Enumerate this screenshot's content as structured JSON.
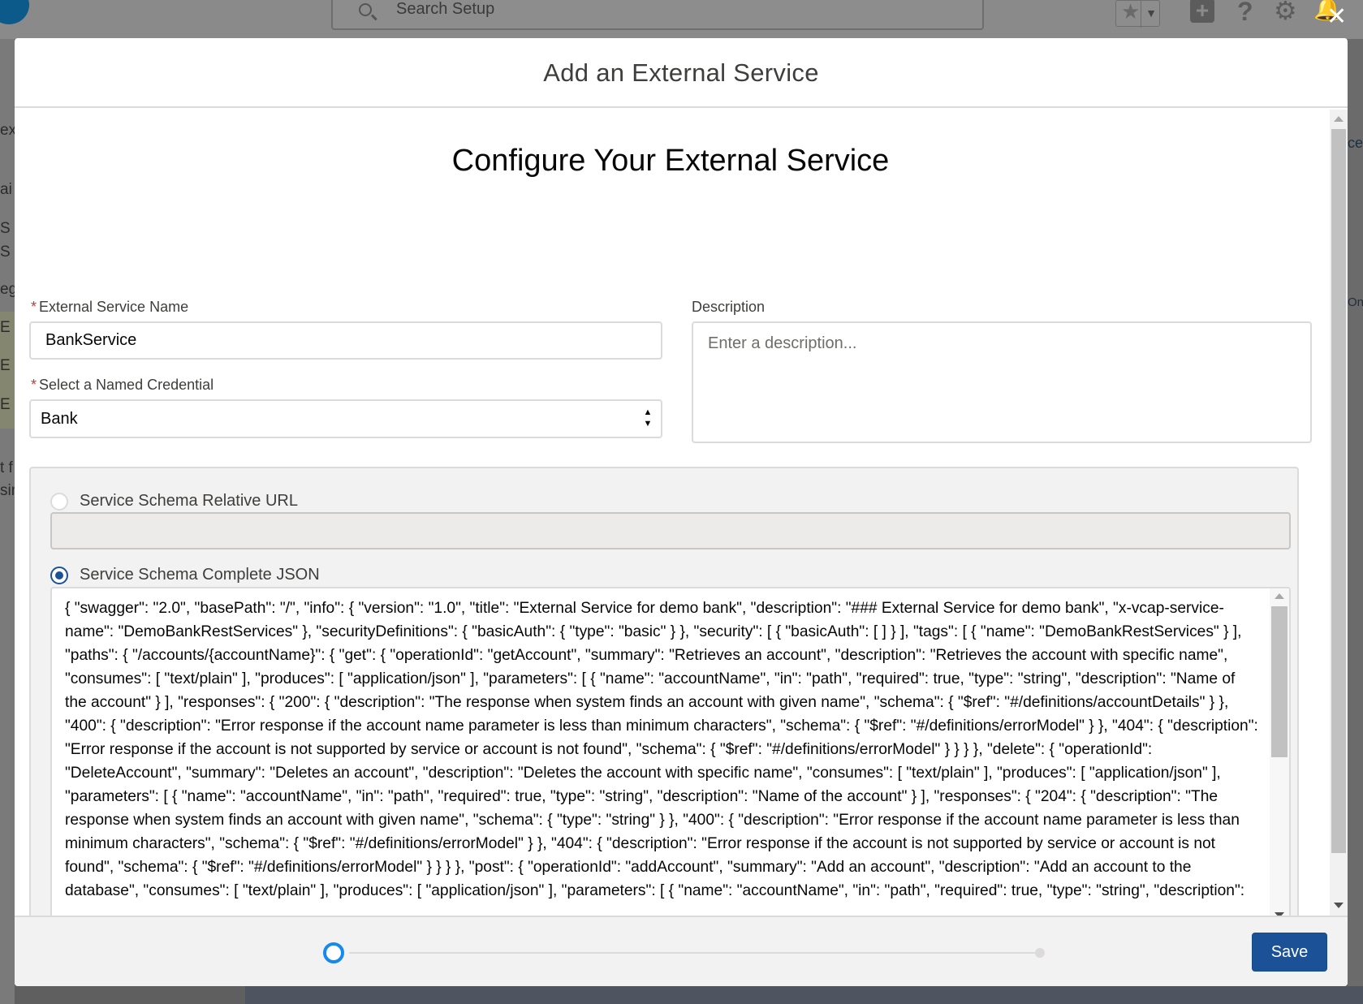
{
  "background": {
    "search_placeholder": "Search Setup",
    "left_fragments": [
      "ex",
      "ai",
      "S",
      "S",
      "eg",
      "E",
      "E",
      "E",
      "t f",
      "sin"
    ],
    "right_fragments": [
      "ce",
      "On"
    ]
  },
  "modal": {
    "title": "Add an External Service",
    "close_icon": "close-icon"
  },
  "form": {
    "page_title": "Configure Your External Service",
    "required_marker": "*",
    "service_name": {
      "label": "External Service Name",
      "value": "BankService"
    },
    "named_credential": {
      "label": "Select a Named Credential",
      "selected": "Bank"
    },
    "description": {
      "label": "Description",
      "placeholder": "Enter a description..."
    },
    "schema": {
      "relative_url_label": "Service Schema Relative URL",
      "relative_url_value": "",
      "relative_url_selected": false,
      "complete_json_label": "Service Schema Complete JSON",
      "complete_json_selected": true,
      "json_value": "{ \"swagger\": \"2.0\", \"basePath\": \"/\", \"info\": { \"version\": \"1.0\", \"title\": \"External Service for demo bank\", \"description\": \"### External Service for demo bank\", \"x-vcap-service-name\": \"DemoBankRestServices\" }, \"securityDefinitions\": { \"basicAuth\": { \"type\": \"basic\" } }, \"security\": [ { \"basicAuth\": [ ] } ], \"tags\": [ { \"name\": \"DemoBankRestServices\" } ], \"paths\": { \"/accounts/{accountName}\": { \"get\": { \"operationId\": \"getAccount\", \"summary\": \"Retrieves an account\", \"description\": \"Retrieves the account with specific name\", \"consumes\": [ \"text/plain\" ], \"produces\": [ \"application/json\" ], \"parameters\": [ { \"name\": \"accountName\", \"in\": \"path\", \"required\": true, \"type\": \"string\", \"description\": \"Name of the account\" } ], \"responses\": { \"200\": { \"description\": \"The response when system finds an account with given name\", \"schema\": { \"$ref\": \"#/definitions/accountDetails\" } }, \"400\": { \"description\": \"Error response if the account name parameter is less than minimum characters\", \"schema\": { \"$ref\": \"#/definitions/errorModel\" } }, \"404\": { \"description\": \"Error response if the account is not supported by service or account is not found\", \"schema\": { \"$ref\": \"#/definitions/errorModel\" } } } }, \"delete\": { \"operationId\": \"DeleteAccount\", \"summary\": \"Deletes an account\", \"description\": \"Deletes the account with specific name\", \"consumes\": [ \"text/plain\" ], \"produces\": [ \"application/json\" ], \"parameters\": [ { \"name\": \"accountName\", \"in\": \"path\", \"required\": true, \"type\": \"string\", \"description\": \"Name of the account\" } ], \"responses\": { \"204\": { \"description\": \"The response when system finds an account with given name\", \"schema\": { \"type\": \"string\" } }, \"400\": { \"description\": \"Error response if the account name parameter is less than minimum characters\", \"schema\": { \"$ref\": \"#/definitions/errorModel\" } }, \"404\": { \"description\": \"Error response if the account is not supported by service or account is not found\", \"schema\": { \"$ref\": \"#/definitions/errorModel\" } } } }, \"post\": { \"operationId\": \"addAccount\", \"summary\": \"Add an account\", \"description\": \"Add an account to the database\", \"consumes\": [ \"text/plain\" ], \"produces\": [ \"application/json\" ], \"parameters\": [ { \"name\": \"accountName\", \"in\": \"path\", \"required\": true, \"type\": \"string\", \"description\":"
    }
  },
  "footer": {
    "progress": 0,
    "save_label": "Save"
  },
  "colors": {
    "brand_button": "#1b5297",
    "progress_active": "#1589ee",
    "required": "#c23934"
  }
}
